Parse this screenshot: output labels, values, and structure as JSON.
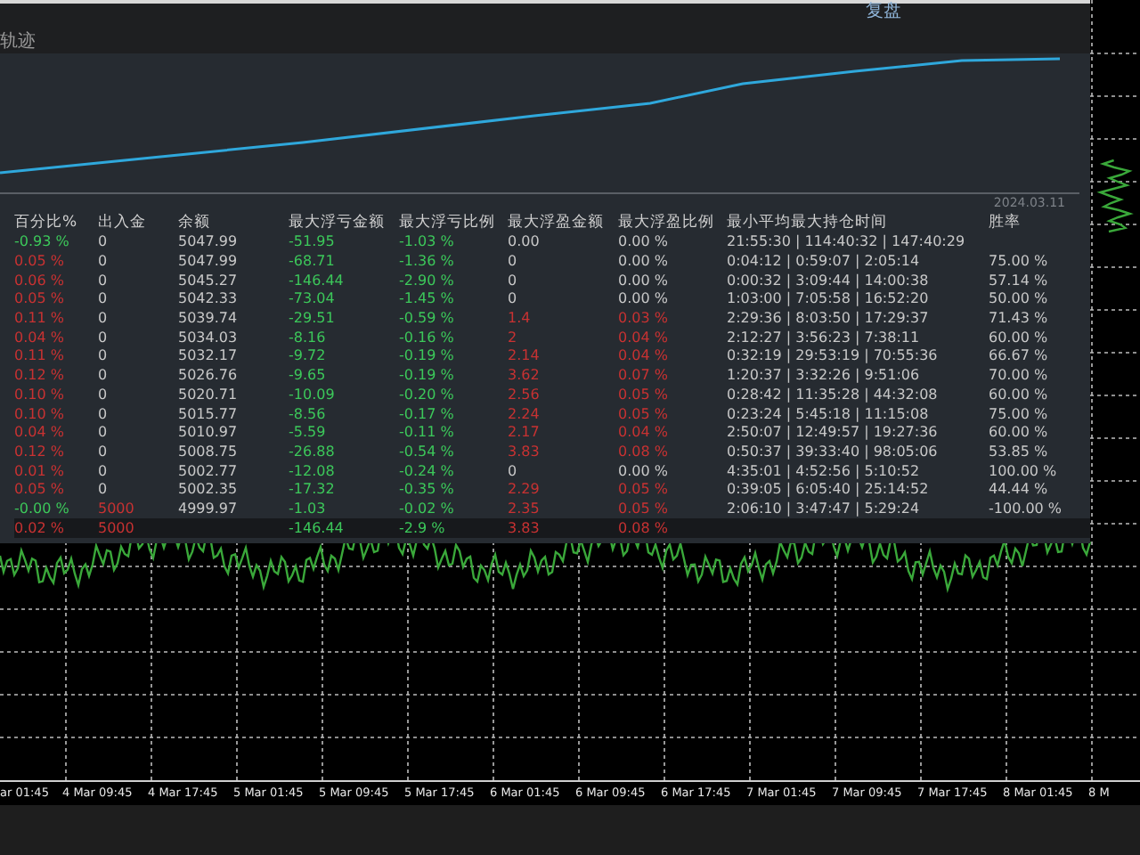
{
  "header": {
    "title": "轨迹",
    "button": "复盘"
  },
  "equity_chart": {
    "date_label": "2024.03.11"
  },
  "table": {
    "columns": [
      "百分比%",
      "出入金",
      "余额",
      "最大浮亏金额",
      "最大浮亏比例",
      "最大浮盈金额",
      "最大浮盈比例",
      "最小平均最大持仓时间",
      "胜率"
    ],
    "rows": [
      [
        {
          "text": "-0.93 %",
          "color": "#3cc85a"
        },
        {
          "text": "0"
        },
        {
          "text": "5047.99"
        },
        {
          "text": "-51.95",
          "color": "#3cc85a"
        },
        {
          "text": "-1.03 %",
          "color": "#3cc85a"
        },
        {
          "text": "0.00"
        },
        {
          "text": "0.00 %"
        },
        {
          "text": "21:55:30 | 114:40:32 | 147:40:29"
        }
      ],
      [
        {
          "text": "0.05 %",
          "color": "#c83232"
        },
        {
          "text": "0"
        },
        {
          "text": "5047.99"
        },
        {
          "text": "-68.71",
          "color": "#3cc85a"
        },
        {
          "text": "-1.36 %",
          "color": "#3cc85a"
        },
        {
          "text": "0"
        },
        {
          "text": "0.00 %"
        },
        {
          "text": "0:04:12 | 0:59:07 | 2:05:14"
        },
        {
          "text": "75.00 %"
        }
      ],
      [
        {
          "text": "0.06 %",
          "color": "#c83232"
        },
        {
          "text": "0"
        },
        {
          "text": "5045.27"
        },
        {
          "text": "-146.44",
          "color": "#3cc85a"
        },
        {
          "text": "-2.90 %",
          "color": "#3cc85a"
        },
        {
          "text": "0"
        },
        {
          "text": "0.00 %"
        },
        {
          "text": "0:00:32 | 3:09:44 | 14:00:38"
        },
        {
          "text": "57.14 %"
        }
      ],
      [
        {
          "text": "0.05 %",
          "color": "#c83232"
        },
        {
          "text": "0"
        },
        {
          "text": "5042.33"
        },
        {
          "text": "-73.04",
          "color": "#3cc85a"
        },
        {
          "text": "-1.45 %",
          "color": "#3cc85a"
        },
        {
          "text": "0"
        },
        {
          "text": "0.00 %"
        },
        {
          "text": "1:03:00 | 7:05:58 | 16:52:20"
        },
        {
          "text": "50.00 %"
        }
      ],
      [
        {
          "text": "0.11 %",
          "color": "#c83232"
        },
        {
          "text": "0"
        },
        {
          "text": "5039.74"
        },
        {
          "text": "-29.51",
          "color": "#3cc85a"
        },
        {
          "text": "-0.59 %",
          "color": "#3cc85a"
        },
        {
          "text": "1.4",
          "color": "#c83232"
        },
        {
          "text": "0.03 %",
          "color": "#c83232"
        },
        {
          "text": "2:29:36 | 8:03:50 | 17:29:37"
        },
        {
          "text": "71.43 %"
        }
      ],
      [
        {
          "text": "0.04 %",
          "color": "#c83232"
        },
        {
          "text": "0"
        },
        {
          "text": "5034.03"
        },
        {
          "text": "-8.16",
          "color": "#3cc85a"
        },
        {
          "text": "-0.16 %",
          "color": "#3cc85a"
        },
        {
          "text": "2",
          "color": "#c83232"
        },
        {
          "text": "0.04 %",
          "color": "#c83232"
        },
        {
          "text": "2:12:27 | 3:56:23 | 7:38:11"
        },
        {
          "text": "60.00 %"
        }
      ],
      [
        {
          "text": "0.11 %",
          "color": "#c83232"
        },
        {
          "text": "0"
        },
        {
          "text": "5032.17"
        },
        {
          "text": "-9.72",
          "color": "#3cc85a"
        },
        {
          "text": "-0.19 %",
          "color": "#3cc85a"
        },
        {
          "text": "2.14",
          "color": "#c83232"
        },
        {
          "text": "0.04 %",
          "color": "#c83232"
        },
        {
          "text": "0:32:19 | 29:53:19 | 70:55:36"
        },
        {
          "text": "66.67 %"
        }
      ],
      [
        {
          "text": "0.12 %",
          "color": "#c83232"
        },
        {
          "text": "0"
        },
        {
          "text": "5026.76"
        },
        {
          "text": "-9.65",
          "color": "#3cc85a"
        },
        {
          "text": "-0.19 %",
          "color": "#3cc85a"
        },
        {
          "text": "3.62",
          "color": "#c83232"
        },
        {
          "text": "0.07 %",
          "color": "#c83232"
        },
        {
          "text": "1:20:37 | 3:32:26 | 9:51:06"
        },
        {
          "text": "70.00 %"
        }
      ],
      [
        {
          "text": "0.10 %",
          "color": "#c83232"
        },
        {
          "text": "0"
        },
        {
          "text": "5020.71"
        },
        {
          "text": "-10.09",
          "color": "#3cc85a"
        },
        {
          "text": "-0.20 %",
          "color": "#3cc85a"
        },
        {
          "text": "2.56",
          "color": "#c83232"
        },
        {
          "text": "0.05 %",
          "color": "#c83232"
        },
        {
          "text": "0:28:42 | 11:35:28 | 44:32:08"
        },
        {
          "text": "60.00 %"
        }
      ],
      [
        {
          "text": "0.10 %",
          "color": "#c83232"
        },
        {
          "text": "0"
        },
        {
          "text": "5015.77"
        },
        {
          "text": "-8.56",
          "color": "#3cc85a"
        },
        {
          "text": "-0.17 %",
          "color": "#3cc85a"
        },
        {
          "text": "2.24",
          "color": "#c83232"
        },
        {
          "text": "0.05 %",
          "color": "#c83232"
        },
        {
          "text": "0:23:24 | 5:45:18 | 11:15:08"
        },
        {
          "text": "75.00 %"
        }
      ],
      [
        {
          "text": "0.04 %",
          "color": "#c83232"
        },
        {
          "text": "0"
        },
        {
          "text": "5010.97"
        },
        {
          "text": "-5.59",
          "color": "#3cc85a"
        },
        {
          "text": "-0.11 %",
          "color": "#3cc85a"
        },
        {
          "text": "2.17",
          "color": "#c83232"
        },
        {
          "text": "0.04 %",
          "color": "#c83232"
        },
        {
          "text": "2:50:07 | 12:49:57 | 19:27:36"
        },
        {
          "text": "60.00 %"
        }
      ],
      [
        {
          "text": "0.12 %",
          "color": "#c83232"
        },
        {
          "text": "0"
        },
        {
          "text": "5008.75"
        },
        {
          "text": "-26.88",
          "color": "#3cc85a"
        },
        {
          "text": "-0.54 %",
          "color": "#3cc85a"
        },
        {
          "text": "3.83",
          "color": "#c83232"
        },
        {
          "text": "0.08 %",
          "color": "#c83232"
        },
        {
          "text": "0:50:37 | 39:33:40 | 98:05:06"
        },
        {
          "text": "53.85 %"
        }
      ],
      [
        {
          "text": "0.01 %",
          "color": "#c83232"
        },
        {
          "text": "0"
        },
        {
          "text": "5002.77"
        },
        {
          "text": "-12.08",
          "color": "#3cc85a"
        },
        {
          "text": "-0.24 %",
          "color": "#3cc85a"
        },
        {
          "text": "0"
        },
        {
          "text": "0.00 %"
        },
        {
          "text": "4:35:01 | 4:52:56 | 5:10:52"
        },
        {
          "text": "100.00 %"
        }
      ],
      [
        {
          "text": "0.05 %",
          "color": "#c83232"
        },
        {
          "text": "0"
        },
        {
          "text": "5002.35"
        },
        {
          "text": "-17.32",
          "color": "#3cc85a"
        },
        {
          "text": "-0.35 %",
          "color": "#3cc85a"
        },
        {
          "text": "2.29",
          "color": "#c83232"
        },
        {
          "text": "0.05 %",
          "color": "#c83232"
        },
        {
          "text": "0:39:05 | 6:05:40 | 25:14:52"
        },
        {
          "text": "44.44 %"
        }
      ],
      [
        {
          "text": "-0.00 %",
          "color": "#3cc85a"
        },
        {
          "text": "5000",
          "color": "#c83232"
        },
        {
          "text": "4999.97"
        },
        {
          "text": "-1.03",
          "color": "#3cc85a"
        },
        {
          "text": "-0.02 %",
          "color": "#3cc85a"
        },
        {
          "text": "2.35",
          "color": "#c83232"
        },
        {
          "text": "0.05 %",
          "color": "#c83232"
        },
        {
          "text": "2:06:10 | 3:47:47 | 5:29:24"
        },
        {
          "text": "-100.00 %"
        }
      ]
    ],
    "totals": {
      "percent": {
        "text": "0.02 %",
        "color": "#c83232"
      },
      "deposit": {
        "text": "5000",
        "color": "#c83232"
      },
      "max_loss": {
        "text": "-146.44",
        "color": "#3cc85a"
      },
      "max_loss_ratio": {
        "text": "-2.9 %",
        "color": "#3cc85a"
      },
      "max_profit": {
        "text": "3.83",
        "color": "#c83232"
      },
      "max_profit_ratio": {
        "text": "0.08 %",
        "color": "#c83232"
      }
    }
  },
  "time_axis": {
    "labels": [
      "ar 01:45",
      "4 Mar 09:45",
      "4 Mar 17:45",
      "5 Mar 01:45",
      "5 Mar 09:45",
      "5 Mar 17:45",
      "6 Mar 01:45",
      "6 Mar 09:45",
      "6 Mar 17:45",
      "7 Mar 01:45",
      "7 Mar 09:45",
      "7 Mar 17:45",
      "8 Mar 01:45",
      "8 M"
    ]
  }
}
